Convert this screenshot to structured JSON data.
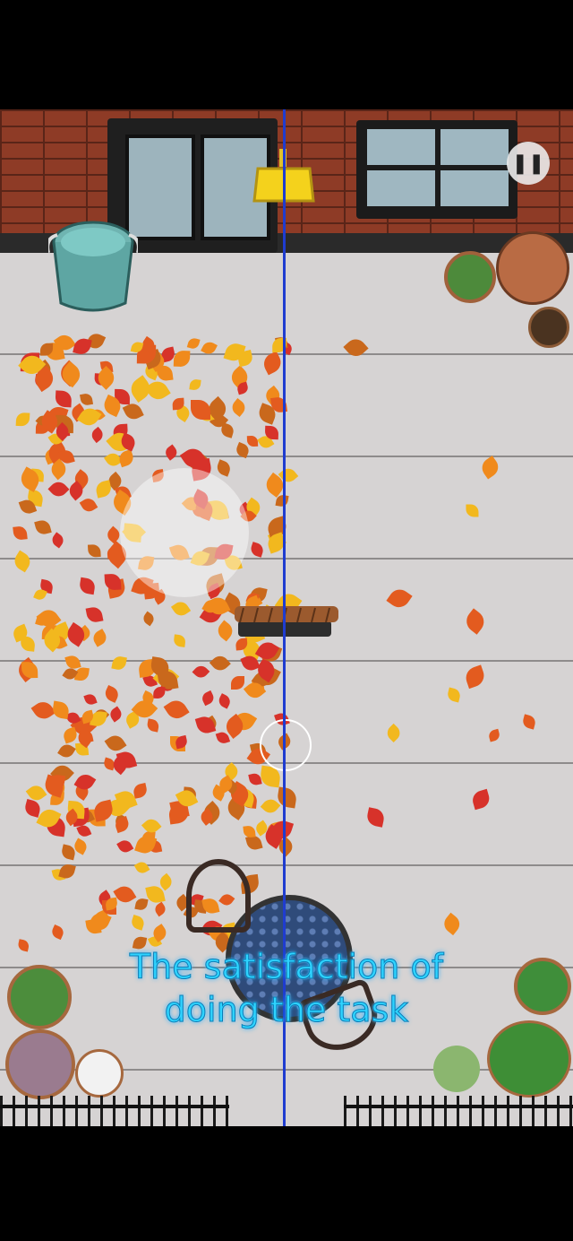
{
  "game": {
    "caption_line1": "The satisfaction of",
    "caption_line2": "doing the task",
    "pause_icon": "pause-icon",
    "colors": {
      "divider": "#1f3cd0",
      "caption": "#2fd3ff",
      "leaf_orange": "#f08a1c",
      "leaf_red": "#d7322a",
      "leaf_yellow": "#f2b81e"
    }
  }
}
